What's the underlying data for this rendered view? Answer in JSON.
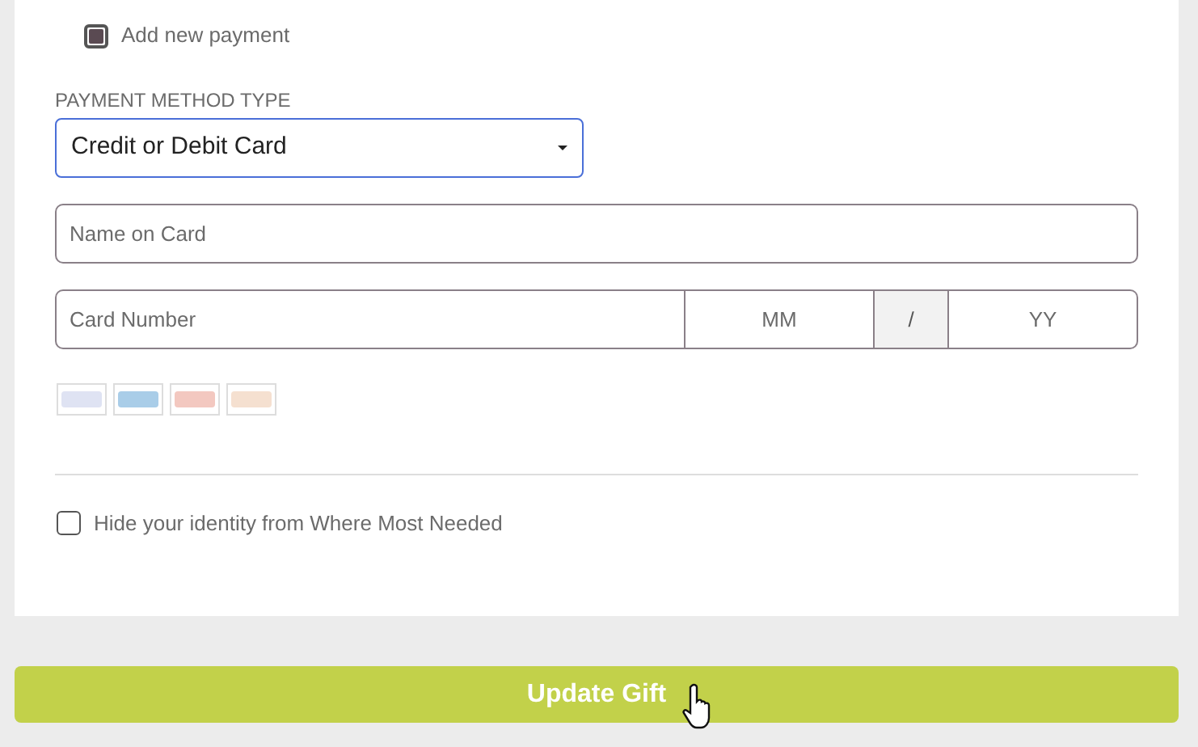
{
  "add_payment": {
    "label": "Add new payment",
    "checked": true
  },
  "payment_method": {
    "label": "PAYMENT METHOD TYPE",
    "value": "Credit or Debit Card"
  },
  "name_field": {
    "placeholder": "Name on Card"
  },
  "card_fields": [
    {
      "placeholder": "Card Number"
    },
    {
      "placeholder": "MM"
    },
    {
      "separator": "/"
    },
    {
      "placeholder": "YY"
    }
  ],
  "card_logos": [
    {
      "color": "#dfe3f3"
    },
    {
      "color": "#a9cde8"
    },
    {
      "color": "#f3c8c0"
    },
    {
      "color": "#f5e0d0"
    }
  ],
  "hide_identity": {
    "label": "Hide your identity from Where Most Needed",
    "checked": false
  },
  "submit_button": {
    "label": "Update Gift"
  }
}
